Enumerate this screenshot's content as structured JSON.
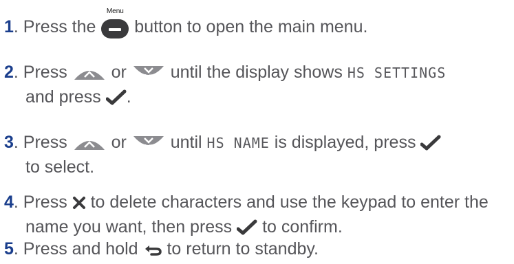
{
  "steps": [
    {
      "num": "1",
      "text_a": ". Press the ",
      "menu_label": "Menu",
      "text_b": " button to open the main menu."
    },
    {
      "num": "2",
      "text_a": ". Press ",
      "redial_label": "Redial",
      "text_b": " or ",
      "calls_label": "Calls",
      "text_c": " until the display shows ",
      "lcd": "HS SETTINGS",
      "text_d": "and press ",
      "text_e": "."
    },
    {
      "num": "3",
      "text_a": ". Press ",
      "redial_label": "Redial",
      "text_b": " or ",
      "calls_label": "Calls",
      "text_c": " until ",
      "lcd": "HS NAME",
      "text_d": " is displayed, press ",
      "text_e": "to select."
    },
    {
      "num": "4",
      "text_a": ". Press ",
      "text_b": " to delete characters and use the keypad to enter the",
      "text_c": "name you want, then press ",
      "text_d": " to confirm."
    },
    {
      "num": "5",
      "text_a": ". Press and hold ",
      "text_b": " to return to standby."
    }
  ],
  "colors": {
    "number": "#1a3e8c",
    "text": "#555559",
    "key": "#8c8c90",
    "key_dark": "#3a3a3c"
  },
  "icons": [
    "menu-button-icon",
    "redial-up-button-icon",
    "calls-down-button-icon",
    "ok-check-icon",
    "delete-x-icon",
    "back-arrow-icon"
  ]
}
